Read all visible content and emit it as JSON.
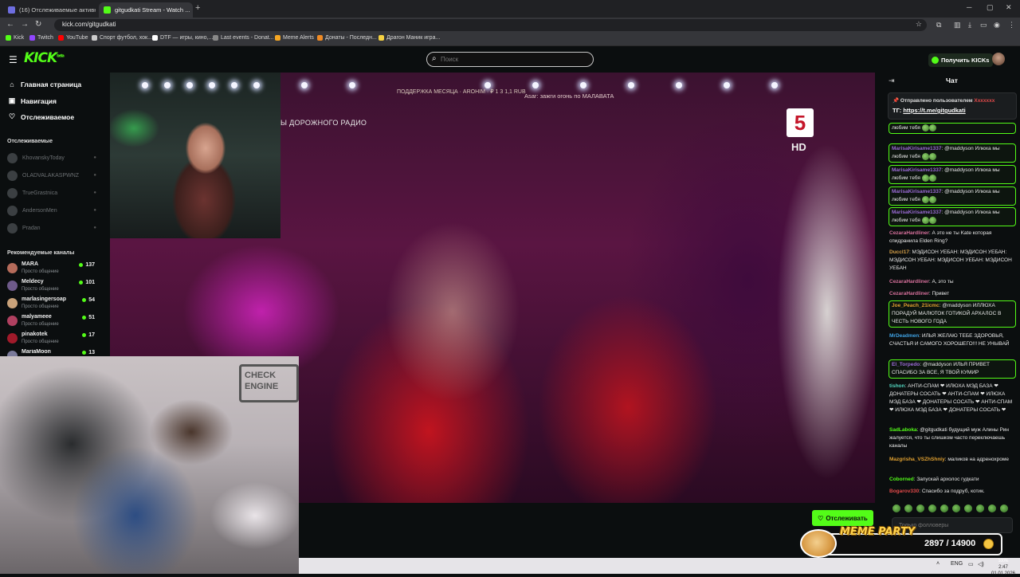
{
  "browser": {
    "tabs": [
      {
        "title": "(16) Отслеживаемые активные...",
        "active": false,
        "favicon_color": "#6e6ee0"
      },
      {
        "title": "gitgudkati Stream - Watch ...",
        "active": true,
        "favicon_color": "#53fc18"
      }
    ],
    "new_tab_icon": "plus-icon",
    "url": "kick.com/gitgudkati",
    "bookmarks": [
      {
        "label": "Kick",
        "color": "#53fc18"
      },
      {
        "label": "Twitch",
        "color": "#9146ff"
      },
      {
        "label": "YouTube",
        "color": "#ff0000"
      },
      {
        "label": "Спорт футбол, хок...",
        "color": "#cccccc"
      },
      {
        "label": "DTF — игры, кино,...",
        "color": "#ffffff"
      },
      {
        "label": "Last events - Donat...",
        "color": "#888888"
      },
      {
        "label": "Meme Alerts",
        "color": "#f5a623"
      },
      {
        "label": "Донаты - Последн...",
        "color": "#f08a24"
      },
      {
        "label": "Драгон Маник игра...",
        "color": "#f5d142"
      }
    ]
  },
  "header": {
    "logo": "KICK",
    "logo_sup": "beta",
    "search_placeholder": "Поиск",
    "get_kicks": "Получить KICKs",
    "accent": "#53fc18"
  },
  "sidebar": {
    "nav": [
      {
        "label": "Главная страница",
        "icon": "home-icon",
        "glyph": "⌂"
      },
      {
        "label": "Навигация",
        "icon": "compass-icon",
        "glyph": "▣"
      },
      {
        "label": "Отслеживаемое",
        "icon": "heart-icon",
        "glyph": "♡"
      }
    ],
    "followed_title": "Отслеживаемые",
    "followed": [
      "KhovanskyToday",
      "OLADVALAKASPWNZ",
      "TrueGrastnica",
      "AndersonMen",
      "Pradan"
    ],
    "recommended_title": "Рекомендуемые каналы",
    "recommended": [
      {
        "name": "MARA",
        "category": "Просто общение",
        "viewers": "137",
        "color": "#b56b5a"
      },
      {
        "name": "Meldecy",
        "category": "Просто общение",
        "viewers": "101",
        "color": "#6e5a8a"
      },
      {
        "name": "marlasingersoap",
        "category": "Просто общение",
        "viewers": "54",
        "color": "#c9a27a"
      },
      {
        "name": "malyameee",
        "category": "Просто общение",
        "viewers": "51",
        "color": "#b04060"
      },
      {
        "name": "pinakotek",
        "category": "Просто общение",
        "viewers": "17",
        "color": "#a01a2a"
      },
      {
        "name": "MariaMoon",
        "category": "",
        "viewers": "13",
        "color": "#7a7a9a"
      }
    ]
  },
  "video": {
    "channel_logo": "5",
    "channel_hd": "HD",
    "radio_text": "Ы ДОРОЖНОГО РАДИО",
    "ticker": "ПОДДЕРЖКА МЕСЯЦА  ·  AROHIM  ·  ₽ 1 3 1,1 RUB",
    "ticker2": "Asar: зажги огонь по МАЛАВАТА",
    "sign_text": "CHECK ENGINE"
  },
  "follow_button": {
    "label": "Отслеживать",
    "icon": "heart-icon"
  },
  "chat": {
    "title": "Чат",
    "pinned": {
      "line1_prefix": "Отправлено пользователем",
      "line1_user": "Xxxxxxx",
      "line2_prefix": "ТГ:",
      "line2_link": "https://t.me/gitgudkati"
    },
    "messages": [
      {
        "user": "",
        "text": "любим тебя",
        "emotes": 2,
        "color": "#9b6bd6",
        "hl": true
      },
      {
        "user": "MarisaKirisame1337",
        "text": ": @maddyson Илюха мы любим тебя",
        "emotes": 2,
        "color": "#9b6bd6",
        "hl": true
      },
      {
        "user": "MarisaKirisame1337",
        "text": ": @maddyson Илюха мы любим тебя",
        "emotes": 2,
        "color": "#9b6bd6",
        "hl": true
      },
      {
        "user": "MarisaKirisame1337",
        "text": ": @maddyson Илюха мы любим тебя",
        "emotes": 2,
        "color": "#9b6bd6",
        "hl": true
      },
      {
        "user": "MarisaKirisame1337",
        "text": ": @maddyson Илюха мы любим тебя",
        "emotes": 2,
        "color": "#9b6bd6",
        "hl": true
      },
      {
        "user": "CezaraHardliner",
        "text": ": А это не ты Kate которая спидранила Elden Ring?",
        "emotes": 0,
        "color": "#d6709b",
        "hl": false
      },
      {
        "user": "Duccl17",
        "text": ": МЭДИСОН УЕБАН: МЭДИСОН УЕБАН: МЭДИСОН УЕБАН: МЭДИСОН УЕБАН: МЭДИСОН УЕБАН",
        "emotes": 0,
        "color": "#d6a04a",
        "hl": false
      },
      {
        "user": "CezaraHardliner",
        "text": ": А, это ты",
        "emotes": 0,
        "color": "#d6709b",
        "hl": false
      },
      {
        "user": "CezaraHardliner",
        "text": ": Привет",
        "emotes": 0,
        "color": "#d6709b",
        "hl": false
      },
      {
        "user": "Joe_Peach_21icmc",
        "text": ": @maddyson ИЛЛЮХА ПОРАДУЙ МАЛЮТОК ГОТИКОЙ АРХАЛОС В ЧЕСТЬ НОВОГО ГОДА",
        "emotes": 0,
        "color": "#e0a030",
        "hl": true
      },
      {
        "user": "MrDeadmen",
        "text": ": ИЛЬЯ ЖЕЛАЮ ТЕБЕ ЗДОРОВЬЯ, СЧАСТЬЯ И САМОГО ХОРОШЕГО!!! НЕ УНЫВАЙ",
        "emotes": 0,
        "color": "#3fa0e0",
        "hl": false
      },
      {
        "user": "El_Torpedo",
        "text": ": @maddyson ИЛЬЯ ПРИВЕТ СПАСИБО ЗА ВСЕ, Я ТВОЙ КУМИР",
        "emotes": 0,
        "color": "#9b6bd6",
        "hl": true
      },
      {
        "user": "tishon",
        "text": ": АНТИ-СПАМ ❤ ИЛЮХА МЭД БАЗА ❤ ДОНАТЕРЫ СОСАТЬ ❤ АНТИ-СПАМ ❤ ИЛЮХА МЭД БАЗА ❤ ДОНАТЕРЫ СОСАТЬ ❤ АНТИ-СПАМ ❤ ИЛЮХА МЭД БАЗА ❤ ДОНАТЕРЫ СОСАТЬ ❤",
        "emotes": 0,
        "color": "#53d6c0",
        "hl": false
      },
      {
        "user": "SadLaboka",
        "text": ": @gitgudkati будущий муж Алины Рин жалуется, что ты слишком часто переключаешь каналы",
        "emotes": 0,
        "color": "#53fc18",
        "hl": false
      },
      {
        "user": "Mazgrisha_VSZhShniy",
        "text": ": маликов на адренохроме",
        "emotes": 0,
        "color": "#e0a030",
        "hl": false
      },
      {
        "user": "Coborned",
        "text": ": Запускай архолос гудкати",
        "emotes": 0,
        "color": "#53fc18",
        "hl": false
      },
      {
        "user": "Bogarov330",
        "text": ": Спасибо за подруб, котик.",
        "emotes": 0,
        "color": "#e14a4a",
        "hl": false
      }
    ],
    "input_placeholder": "Только фолловеры"
  },
  "overlay": {
    "title": "MEME PARTY",
    "progress": "2897 / 14900",
    "progress_current": 2897,
    "progress_goal": 14900
  },
  "taskbar": {
    "lang": "ENG",
    "time": "2:47",
    "date": "01.01.2026",
    "battery": "100%"
  }
}
